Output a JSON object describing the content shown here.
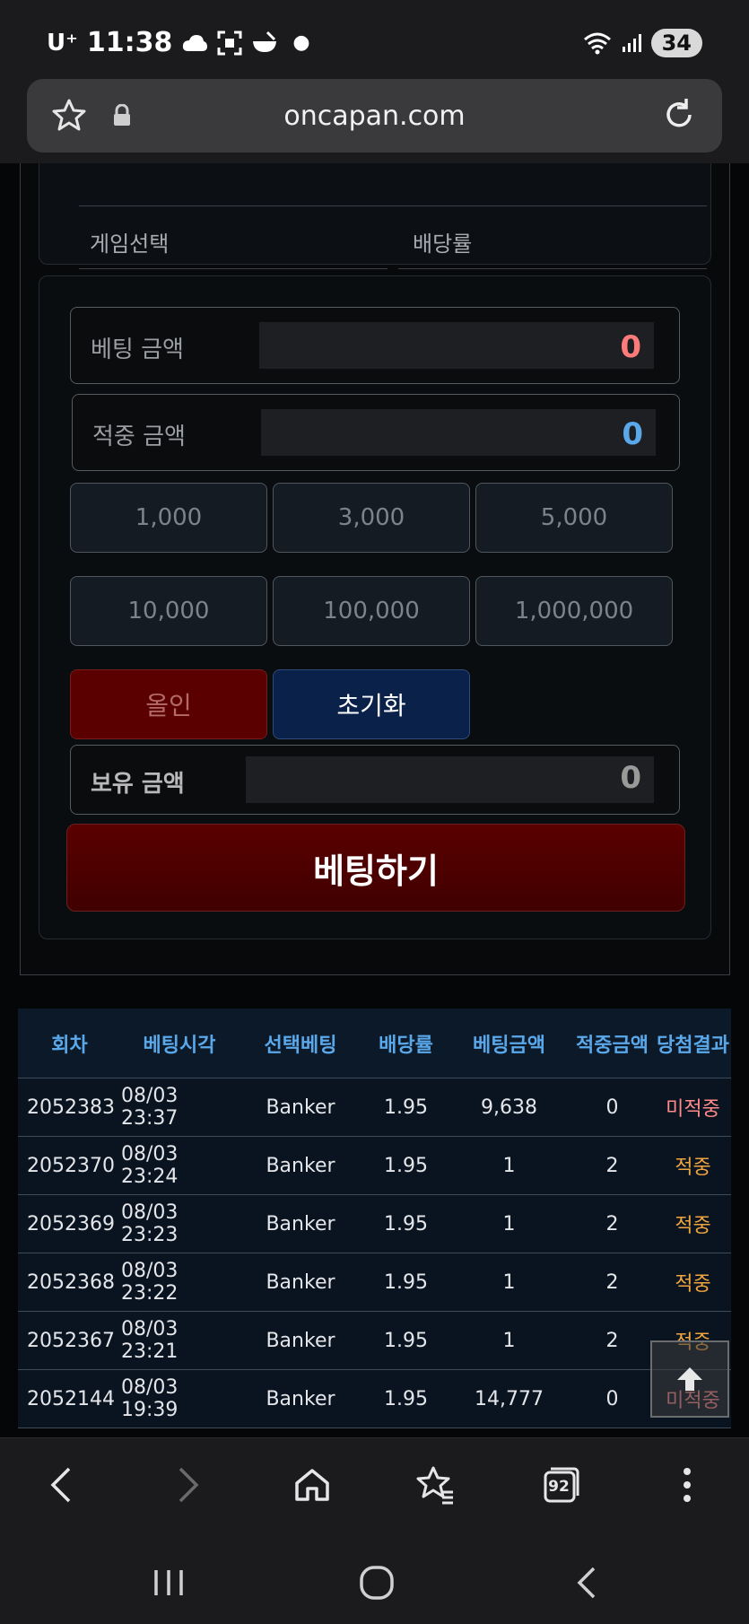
{
  "status_bar": {
    "carrier": "U⁺",
    "time": "11:38",
    "battery": "34"
  },
  "browser": {
    "url": "oncapan.com",
    "tab_count": "92"
  },
  "info": {
    "game_select_label": "게임선택",
    "odds_label": "배당률"
  },
  "bet_form": {
    "bet_amount_label": "베팅 금액",
    "bet_amount_value": "0",
    "win_amount_label": "적중 금액",
    "win_amount_value": "0",
    "chips": [
      "1,000",
      "3,000",
      "5,000",
      "10,000",
      "100,000",
      "1,000,000"
    ],
    "allin_label": "올인",
    "reset_label": "초기화",
    "balance_label": "보유 금액",
    "balance_value": "0",
    "submit_label": "베팅하기"
  },
  "history": {
    "headers": [
      "회차",
      "베팅시각",
      "선택베팅",
      "배당률",
      "베팅금액",
      "적중금액",
      "당첨결과"
    ],
    "rows": [
      [
        "2052383",
        "08/03 23:37",
        "Banker",
        "1.95",
        "9,638",
        "0",
        "미적중"
      ],
      [
        "2052370",
        "08/03 23:24",
        "Banker",
        "1.95",
        "1",
        "2",
        "적중"
      ],
      [
        "2052369",
        "08/03 23:23",
        "Banker",
        "1.95",
        "1",
        "2",
        "적중"
      ],
      [
        "2052368",
        "08/03 23:22",
        "Banker",
        "1.95",
        "1",
        "2",
        "적중"
      ],
      [
        "2052367",
        "08/03 23:21",
        "Banker",
        "1.95",
        "1",
        "2",
        "적중"
      ],
      [
        "2052144",
        "08/03 19:39",
        "Banker",
        "1.95",
        "14,777",
        "0",
        "미적중"
      ]
    ]
  },
  "colors": {
    "bet_amount": "#ff7b7b",
    "win_amount": "#5aa8ea",
    "balance": "#9a9a9a",
    "result_miss": "#ff8a8a",
    "result_hit": "#f0a640"
  }
}
